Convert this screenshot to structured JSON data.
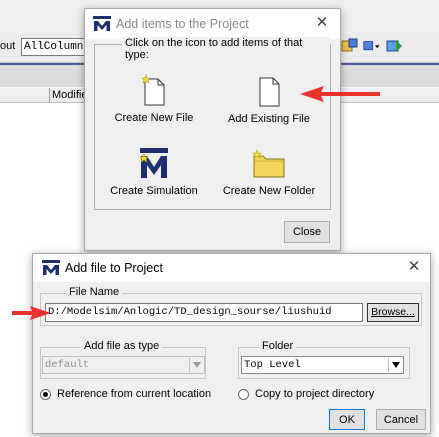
{
  "background": {
    "toolbar_label": "out",
    "combo_value": "AllColumn",
    "table_header_modified": "Modifie"
  },
  "add_items_dialog": {
    "title": "Add items to the Project",
    "group_label": "Click on the icon to add items of that type:",
    "items": [
      {
        "label": "Create New File",
        "icon": "new-file-icon"
      },
      {
        "label": "Add Existing File",
        "icon": "existing-file-icon"
      },
      {
        "label": "Create Simulation",
        "icon": "simulation-icon"
      },
      {
        "label": "Create New Folder",
        "icon": "folder-icon"
      }
    ],
    "close_label": "Close"
  },
  "add_file_dialog": {
    "title": "Add file to Project",
    "file_name_label": "File Name",
    "file_name_value": "D:/Modelsim/Anlogic/TD_design_sourse/liushuid",
    "browse_label": "Browse...",
    "file_type_label": "Add file as type",
    "file_type_value": "default",
    "folder_label": "Folder",
    "folder_value": "Top Level",
    "radio_reference": "Reference from current location",
    "radio_copy": "Copy to project directory",
    "selected_radio": "reference",
    "ok_label": "OK",
    "cancel_label": "Cancel"
  },
  "colors": {
    "annotation_arrow": "#e8322b",
    "modelsim_blue": "#1e2f6e",
    "folder_yellow": "#f2d45c"
  }
}
